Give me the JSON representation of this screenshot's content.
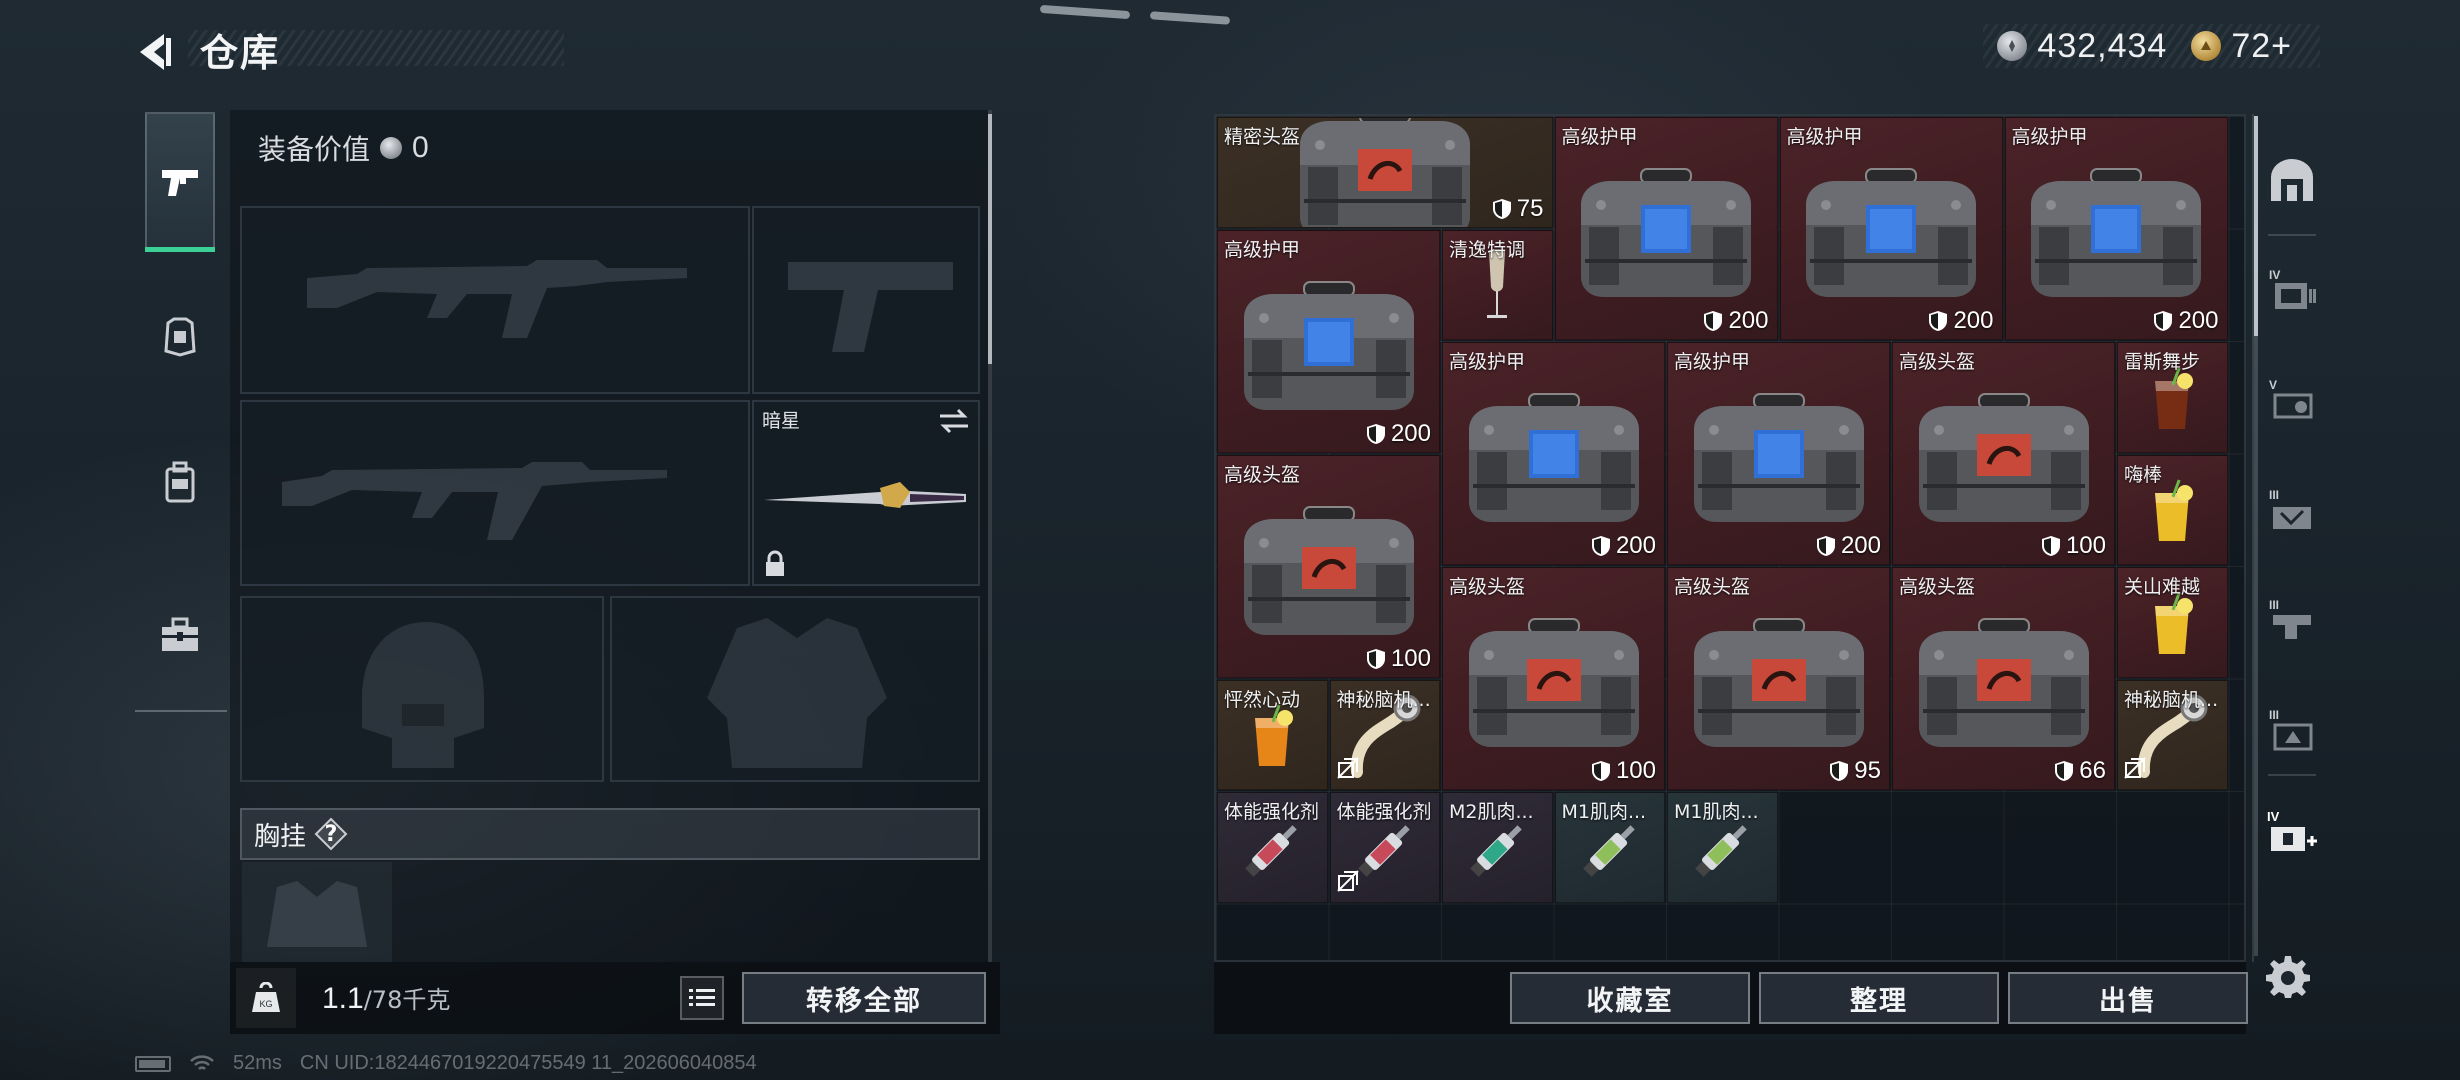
{
  "header": {
    "title": "仓库",
    "currencies": [
      {
        "icon": "silver-coin-icon",
        "value": "432,434"
      },
      {
        "icon": "gold-coin-icon",
        "value": "72+"
      }
    ]
  },
  "left_tabs": [
    {
      "name": "tab-weapons",
      "icon": "pistol-icon",
      "active": true
    },
    {
      "name": "tab-armor",
      "icon": "armor-icon",
      "active": false
    },
    {
      "name": "tab-backpack",
      "icon": "backpack-icon",
      "active": false
    },
    {
      "name": "tab-supplies",
      "icon": "toolbox-icon",
      "active": false
    }
  ],
  "loadout": {
    "equip_value_label": "装备价值",
    "equip_value": "0",
    "melee_label": "暗星",
    "chest_label": "胸挂",
    "help": "?"
  },
  "bottom_left": {
    "weight": "1.1",
    "weight_max": "/78千克",
    "transfer_all": "转移全部"
  },
  "stash": {
    "items": [
      {
        "name": "精密头盔",
        "dura": "75",
        "kind": "helmet",
        "bg": "brown"
      },
      {
        "name": "高级护甲",
        "dura": "200",
        "kind": "armor",
        "bg": "red"
      },
      {
        "name": "高级护甲",
        "dura": "200",
        "kind": "armor",
        "bg": "red"
      },
      {
        "name": "高级护甲",
        "dura": "200",
        "kind": "armor",
        "bg": "red"
      },
      {
        "name": "高级护甲",
        "dura": "200",
        "kind": "armor",
        "bg": "red"
      },
      {
        "name": "清逸特调",
        "dura": "",
        "kind": "champagne",
        "bg": "red"
      },
      {
        "name": "高级护甲",
        "dura": "200",
        "kind": "armor",
        "bg": "red"
      },
      {
        "name": "高级护甲",
        "dura": "200",
        "kind": "armor",
        "bg": "red"
      },
      {
        "name": "高级头盔",
        "dura": "100",
        "kind": "helmet",
        "bg": "red"
      },
      {
        "name": "雷斯舞步",
        "dura": "",
        "kind": "cocktail-dark",
        "bg": "red"
      },
      {
        "name": "高级头盔",
        "dura": "100",
        "kind": "helmet",
        "bg": "red"
      },
      {
        "name": "嗨棒",
        "dura": "",
        "kind": "cocktail-yellow",
        "bg": "red"
      },
      {
        "name": "高级头盔",
        "dura": "100",
        "kind": "helmet",
        "bg": "red"
      },
      {
        "name": "高级头盔",
        "dura": "95",
        "kind": "helmet",
        "bg": "red"
      },
      {
        "name": "高级头盔",
        "dura": "66",
        "kind": "helmet",
        "bg": "red"
      },
      {
        "name": "关山难越",
        "dura": "",
        "kind": "cocktail-yellow",
        "bg": "red"
      },
      {
        "name": "怦然心动",
        "dura": "",
        "kind": "cocktail-orange",
        "bg": "brown"
      },
      {
        "name": "神秘脑机...",
        "dura": "",
        "kind": "brain",
        "bg": "brown"
      },
      {
        "name": "神秘脑机...",
        "dura": "",
        "kind": "brain",
        "bg": "brown"
      },
      {
        "name": "体能强化剂",
        "dura": "",
        "kind": "syringe-red",
        "bg": "purple"
      },
      {
        "name": "体能强化剂",
        "dura": "",
        "kind": "syringe-red",
        "bg": "purple"
      },
      {
        "name": "M2肌肉...",
        "dura": "",
        "kind": "syringe-teal",
        "bg": "purple"
      },
      {
        "name": "M1肌肉...",
        "dura": "",
        "kind": "syringe-green",
        "bg": "teal"
      },
      {
        "name": "M1肌肉...",
        "dura": "",
        "kind": "syringe-green",
        "bg": "teal"
      }
    ]
  },
  "stash_buttons": {
    "collection": "收藏室",
    "sort": "整理",
    "sell": "出售"
  },
  "right_tabs": [
    {
      "name": "rtab-all",
      "icon": "shelter-icon"
    },
    {
      "name": "rtab-iv-storage",
      "icon": "storage-iv-icon"
    },
    {
      "name": "rtab-v-gun",
      "icon": "gun-case-v-icon"
    },
    {
      "name": "rtab-iii-case",
      "icon": "case-iii-icon"
    },
    {
      "name": "rtab-iii-rack",
      "icon": "rack-iii-icon"
    },
    {
      "name": "rtab-iii-box",
      "icon": "box-iii-icon"
    },
    {
      "name": "rtab-iv-medical",
      "icon": "medical-iv-icon"
    }
  ],
  "statusbar": {
    "ping": "52ms",
    "uid": "CN UID:1824467019220475549 11_202606040854"
  },
  "colors": {
    "accent_green": "#3ccf96",
    "cell_red": "#4b2328",
    "cell_brown": "#3c3025",
    "cell_purple": "#2f2a37"
  }
}
